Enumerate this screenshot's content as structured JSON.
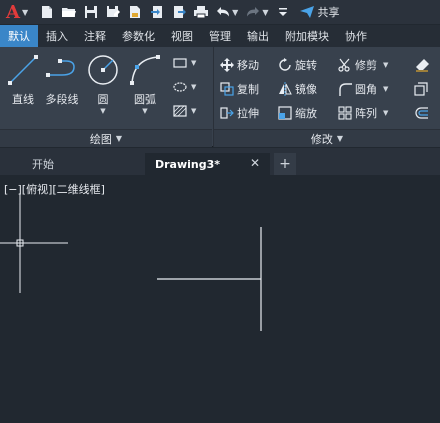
{
  "quick_access": {
    "app_letter": "A",
    "share_label": "共享",
    "icons": [
      "new-file-icon",
      "open-folder-icon",
      "save-icon",
      "save-as-icon",
      "publish-icon",
      "import-icon",
      "export-icon",
      "print-icon",
      "undo-icon",
      "redo-icon",
      "customize-icon",
      "share-icon"
    ]
  },
  "ribbon_tabs": [
    {
      "label": "默认",
      "active": true
    },
    {
      "label": "插入"
    },
    {
      "label": "注释"
    },
    {
      "label": "参数化"
    },
    {
      "label": "视图"
    },
    {
      "label": "管理"
    },
    {
      "label": "输出"
    },
    {
      "label": "附加模块"
    },
    {
      "label": "协作"
    }
  ],
  "draw_panel": {
    "title": "绘图",
    "tools": {
      "line": "直线",
      "polyline": "多段线",
      "circle": "圆",
      "arc": "圆弧"
    }
  },
  "modify_panel": {
    "title": "修改",
    "tools": {
      "move": "移动",
      "rotate": "旋转",
      "trim": "修剪",
      "copy": "复制",
      "mirror": "镜像",
      "fillet": "圆角",
      "stretch": "拉伸",
      "scale": "缩放",
      "array": "阵列"
    }
  },
  "doc_tabs": {
    "start": "开始",
    "active": "Drawing3*",
    "close_glyph": "✕",
    "add_glyph": "+"
  },
  "canvas": {
    "view_label": "[−][俯视][二维线框]"
  },
  "colors": {
    "accent": "#3a86c8",
    "canvas_bg": "#212830",
    "ribbon_bg": "#38414d",
    "app_logo": "#e23b3b"
  }
}
